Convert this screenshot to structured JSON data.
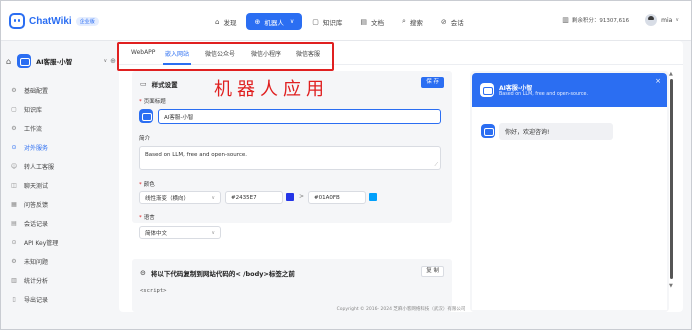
{
  "brand": {
    "name": "ChatWiki",
    "badge": "企业版"
  },
  "topnav": [
    {
      "label": "发现",
      "icon": "⌂"
    },
    {
      "label": "机器人",
      "icon": "⊕",
      "active": true
    },
    {
      "label": "知识库",
      "icon": "▢"
    },
    {
      "label": "文档",
      "icon": "▤"
    },
    {
      "label": "搜索",
      "icon": "⌕"
    },
    {
      "label": "会话",
      "icon": "⊘"
    }
  ],
  "account": {
    "credits": "剩余积分：91307,616",
    "user": "mia"
  },
  "bot": {
    "name": "AI客服-小智"
  },
  "sidebar": [
    {
      "label": "基础配置",
      "icon": "⚙"
    },
    {
      "label": "知识库",
      "icon": "▢"
    },
    {
      "label": "工作流",
      "icon": "⚙"
    },
    {
      "label": "对外服务",
      "icon": "⊙",
      "active": true
    },
    {
      "label": "转人工客服",
      "icon": "☺"
    },
    {
      "label": "聊天测试",
      "icon": "◫"
    },
    {
      "label": "问答反馈",
      "icon": "▦"
    },
    {
      "label": "会话记录",
      "icon": "▤"
    },
    {
      "label": "API Key管理",
      "icon": "⊙"
    },
    {
      "label": "未知问题",
      "icon": "⚙"
    },
    {
      "label": "统计分析",
      "icon": "▥"
    },
    {
      "label": "导出记录",
      "icon": "▯"
    }
  ],
  "tabs": [
    "WebAPP",
    "嵌入网站",
    "微信公众号",
    "微信小程序",
    "微信客服"
  ],
  "style_settings": {
    "title": "样式设置",
    "save": "保 存",
    "overlay_title": "机器人应用",
    "page_title_label": "页面标题",
    "page_title_value": "AI客服-小智",
    "intro_label": "简介",
    "intro_value": "Based on LLM, free and open-source.",
    "color_label": "颜色",
    "gradient_value": "线性渐变（横向）",
    "color_from": "#2435E7",
    "color_to": "#01A0FB",
    "lang_label": "语言",
    "lang_value": "简体中文"
  },
  "code_section": {
    "title": "将以下代码复制到网站代码的< /body>标签之前",
    "copy": "复 制",
    "code": "<script>"
  },
  "preview": {
    "title": "AI客服-小智",
    "subtitle": "Based on LLM, free and open-source.",
    "greeting": "你好，欢迎咨询!"
  },
  "footer": "Copyright © 2016- 2024 芝麻小客网络科技（武汉）有限公司",
  "colors": {
    "accent": "#2b6ef2",
    "highlight": "#e02020",
    "swatch_from": "#2435E7",
    "swatch_to": "#01A0FB"
  }
}
